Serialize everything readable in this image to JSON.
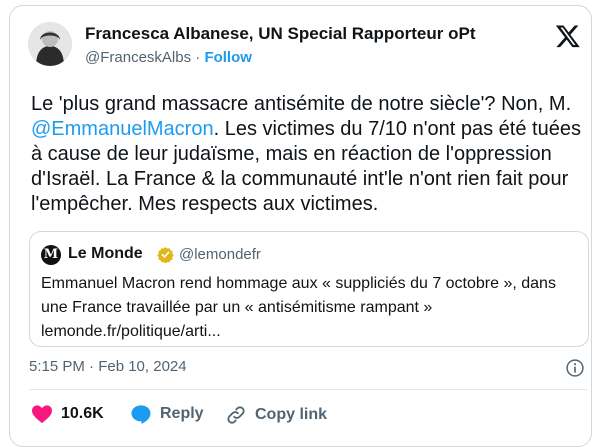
{
  "author": {
    "name": "Francesca Albanese, UN Special Rapporteur oPt",
    "handle": "@FranceskAlbs",
    "separator": "·",
    "follow_label": "Follow"
  },
  "tweet": {
    "text_before": "Le 'plus grand massacre antisémite de notre siècle'? Non, M. ",
    "mention": "@EmmanuelMacron",
    "text_after": ". Les victimes du 7/10 n'ont pas été tuées à cause de leur judaïsme, mais en réaction de l'oppression d'Israël. La France & la communauté int'le n'ont rien fait pour l'empêcher. Mes respects aux victimes."
  },
  "quoted": {
    "logo_letter": "M",
    "name": "Le Monde",
    "handle": "@lemondefr",
    "text": "Emmanuel Macron rend hommage aux « suppliciés du 7 octobre », dans une France travaillée par un « antisémitisme rampant » lemonde.fr/politique/arti..."
  },
  "meta": {
    "timestamp": "5:15 PM · Feb 10, 2024"
  },
  "actions": {
    "like_count": "10.6K",
    "reply_label": "Reply",
    "copy_label": "Copy link"
  },
  "colors": {
    "accent": "#1d9bf0",
    "like": "#f91880",
    "muted": "#536471",
    "border": "#cfd9de"
  }
}
